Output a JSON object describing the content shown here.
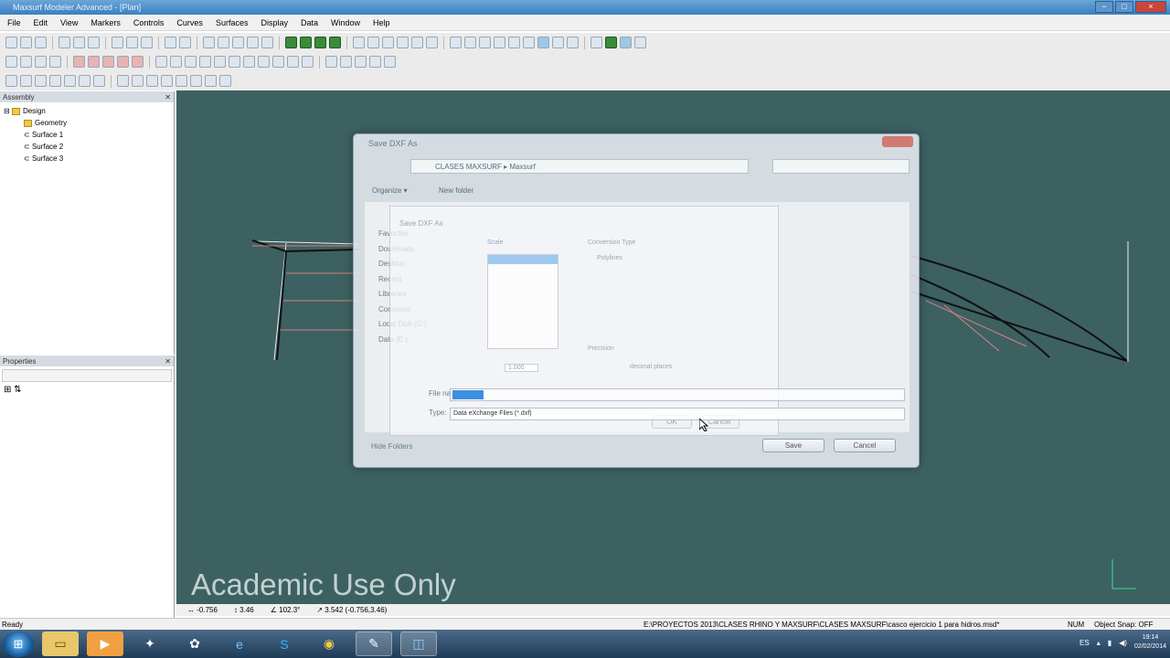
{
  "window": {
    "title": "Maxsurf Modeler Advanced - [Plan]",
    "controls": [
      "−",
      "□",
      "×"
    ]
  },
  "menu": [
    "File",
    "Edit",
    "View",
    "Markers",
    "Controls",
    "Curves",
    "Surfaces",
    "Display",
    "Data",
    "Window",
    "Help"
  ],
  "assembly": {
    "title": "Assembly",
    "items": [
      "Design",
      "Geometry",
      "Surface 1",
      "Surface 2",
      "Surface 3"
    ]
  },
  "properties": {
    "title": "Properties"
  },
  "viewport": {
    "watermark": "Academic Use Only",
    "background": "#3d6161"
  },
  "coords": {
    "x": "-0.756",
    "y": "3.46",
    "angle": "102.3°",
    "point": "3.542 (-0.756,3.46)"
  },
  "status": {
    "ready": "Ready",
    "path": "E:\\PROYECTOS 2013\\CLASES RHINO Y MAXSURF\\CLASES MAXSURF\\casco ejercicio 1 para hidros.msd*",
    "num": "NUM",
    "snap": "Object Snap: OFF"
  },
  "dialog": {
    "title": "Save DXF As",
    "address": "CLASES MAXSURF ▸ Maxsurf",
    "organize": "Organize ▾",
    "new_folder": "New folder",
    "nav": [
      "Favorites",
      "Downloads",
      "Desktop",
      "Recent",
      "Libraries",
      "Computer",
      "Local Disk (C:)",
      "Data (E:)"
    ],
    "file_name_label": "File name:",
    "type_label": "Type:",
    "type_value": "Data eXchange Files (*.dxf)",
    "hide_folders": "Hide Folders",
    "save_label": "Save",
    "cancel_label": "Cancel",
    "sub": {
      "title": "Save DXF As",
      "scale_label": "Scale",
      "conversion_label": "Conversion Type",
      "polylines_label": "Polylines",
      "precision_label": "Precision",
      "precision_value": "1.000",
      "decimal_places": "decimal places",
      "ok_label": "OK",
      "cancel_label": "Cancel"
    }
  },
  "taskbar": {
    "apps": [
      "folder-icon",
      "media-player-icon",
      "maxsurf-icon",
      "paint-icon",
      "ie-icon",
      "skype-icon",
      "chrome-icon",
      "tool-icon",
      "maxsurf-window-icon"
    ],
    "lang": "ES",
    "time": "19:14",
    "date": "02/02/2014"
  }
}
